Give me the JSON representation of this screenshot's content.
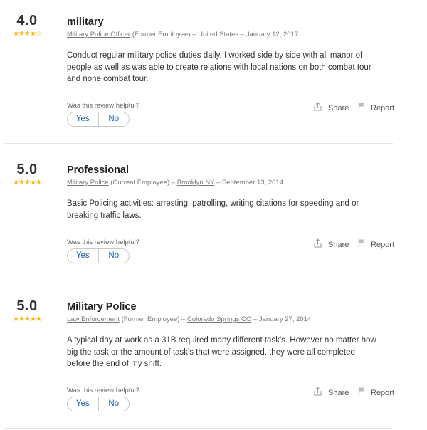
{
  "reviews": [
    {
      "score": "4.0",
      "stars_filled": 4,
      "stars_total": 5,
      "title": "military",
      "job_title": "Military Police Officer",
      "status": "(Former Employee) –",
      "location": "United States",
      "date": "– January 12, 2017",
      "text": "Conduct regular military police duties daily. I worked side by side with all manor of people as well as was able to create relations with local nations on both combat tour and none combat tour.",
      "helpful_question": "Was this review helpful?",
      "yes_label": "Yes",
      "no_label": "No",
      "share_label": "Share",
      "report_label": "Report"
    },
    {
      "score": "5.0",
      "stars_filled": 5,
      "stars_total": 5,
      "title": "Professional",
      "job_title": "Military Police",
      "status": "(Current Employee) –",
      "location": "Brooklyn NY",
      "date": "– September 13, 2014",
      "text": "Basic Policing activities: arresting, patrolling, writing citations for speeding and or breaking traffic laws.",
      "helpful_question": "Was this review helpful?",
      "yes_label": "Yes",
      "no_label": "No",
      "share_label": "Share",
      "report_label": "Report"
    },
    {
      "score": "5.0",
      "stars_filled": 5,
      "stars_total": 5,
      "title": "Military Police",
      "job_title": "Law Enforcement",
      "status": "(Former Employee) –",
      "location": "Colorado Springs CO",
      "date": "– January 27, 2014",
      "text": "A typical day at work as a 31B required many different task's. However no matter how big the task or the amount of task's that were assigned, they were all completed before the end of my shift.",
      "helpful_question": "Was this review helpful?",
      "yes_label": "Yes",
      "no_label": "No",
      "share_label": "Share",
      "report_label": "Report"
    }
  ],
  "colors": {
    "star": "#ffb400",
    "vote_text": "#1d5eb8",
    "divider": "#e4e4e4"
  }
}
